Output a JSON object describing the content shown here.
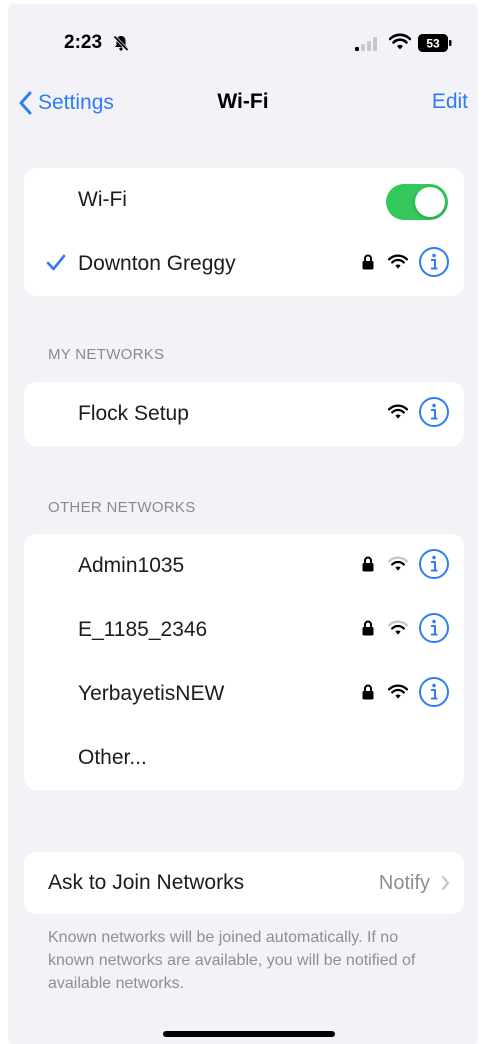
{
  "status_bar": {
    "time": "2:23",
    "battery_level": "53"
  },
  "nav": {
    "back_label": "Settings",
    "title": "Wi-Fi",
    "edit_label": "Edit"
  },
  "wifi_card": {
    "toggle_label": "Wi-Fi",
    "toggle_on": true,
    "connected_network": "Downton Greggy"
  },
  "my_networks": {
    "header": "MY NETWORKS",
    "items": [
      {
        "name": "Flock Setup",
        "secured": false
      }
    ]
  },
  "other_networks": {
    "header": "OTHER NETWORKS",
    "items": [
      {
        "name": "Admin1035",
        "secured": true
      },
      {
        "name": "E_1185_2346",
        "secured": true
      },
      {
        "name": "YerbayetisNEW",
        "secured": true
      }
    ],
    "other_label": "Other..."
  },
  "ask_to_join": {
    "label": "Ask to Join Networks",
    "value": "Notify",
    "footnote": "Known networks will be joined automatically. If no known networks are available, you will be notified of available networks."
  },
  "colors": {
    "accent": "#2f7cf6",
    "toggle_on": "#34c759",
    "background": "#f2f2f7"
  },
  "icons": [
    "bell-slash-icon",
    "cellular-signal-icon",
    "wifi-icon",
    "battery-icon",
    "chevron-left-icon",
    "checkmark-icon",
    "lock-icon",
    "info-icon",
    "chevron-right-icon"
  ]
}
